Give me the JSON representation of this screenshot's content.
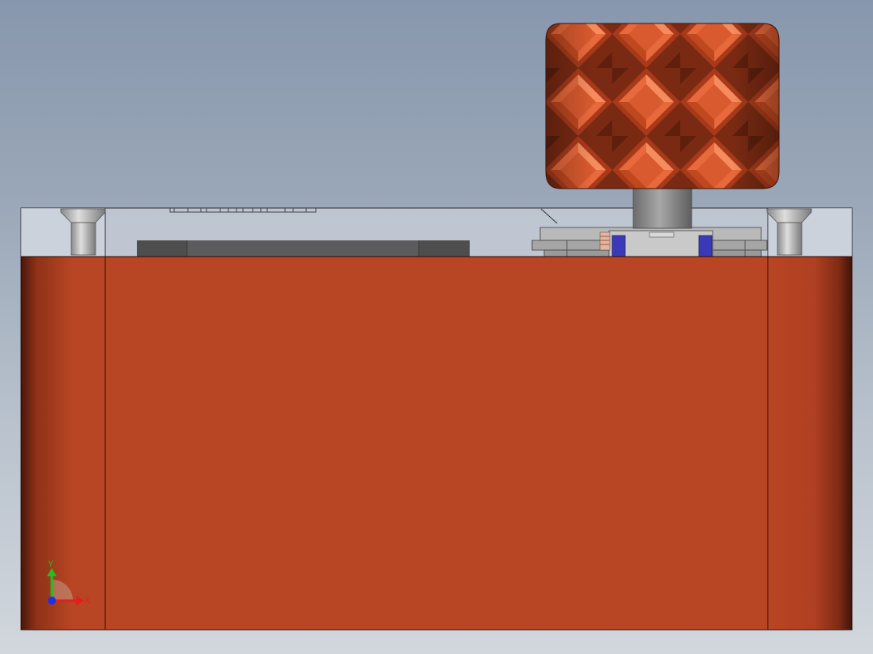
{
  "viewport": {
    "background_top": "#8797ad",
    "background_bottom": "#d2d7dd"
  },
  "model": {
    "base_block_color": "#b84523",
    "base_block_edge_color": "#4a1a0c",
    "knob_face_color": "#f07a4e",
    "knob_shadow_color": "#8a2f14",
    "transparent_cover_color": "#c9cfd8",
    "insert_color": "#5c5c5c",
    "shaft_color": "#8d8d8d",
    "screw_color": "#b8b8b8",
    "switch_accent_color": "#3a3ab8"
  },
  "triad": {
    "x_label": "X",
    "y_label": "Y",
    "x_color": "#e02020",
    "y_color": "#20c020",
    "z_color": "#2030e0"
  }
}
